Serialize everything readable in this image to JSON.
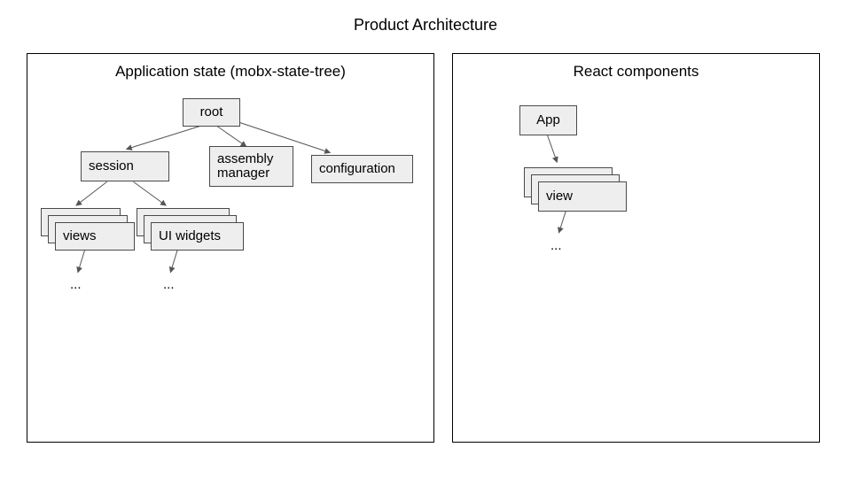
{
  "title": "Product Architecture",
  "left_panel": {
    "title": "Application state (mobx-state-tree)",
    "nodes": {
      "root": "root",
      "session": "session",
      "assembly_manager": "assembly\nmanager",
      "configuration": "configuration",
      "views": "views",
      "ui_widgets": "UI widgets"
    },
    "ellipsis_views": "...",
    "ellipsis_widgets": "..."
  },
  "right_panel": {
    "title": "React components",
    "nodes": {
      "app": "App",
      "view": "view"
    },
    "ellipsis_view": "..."
  }
}
